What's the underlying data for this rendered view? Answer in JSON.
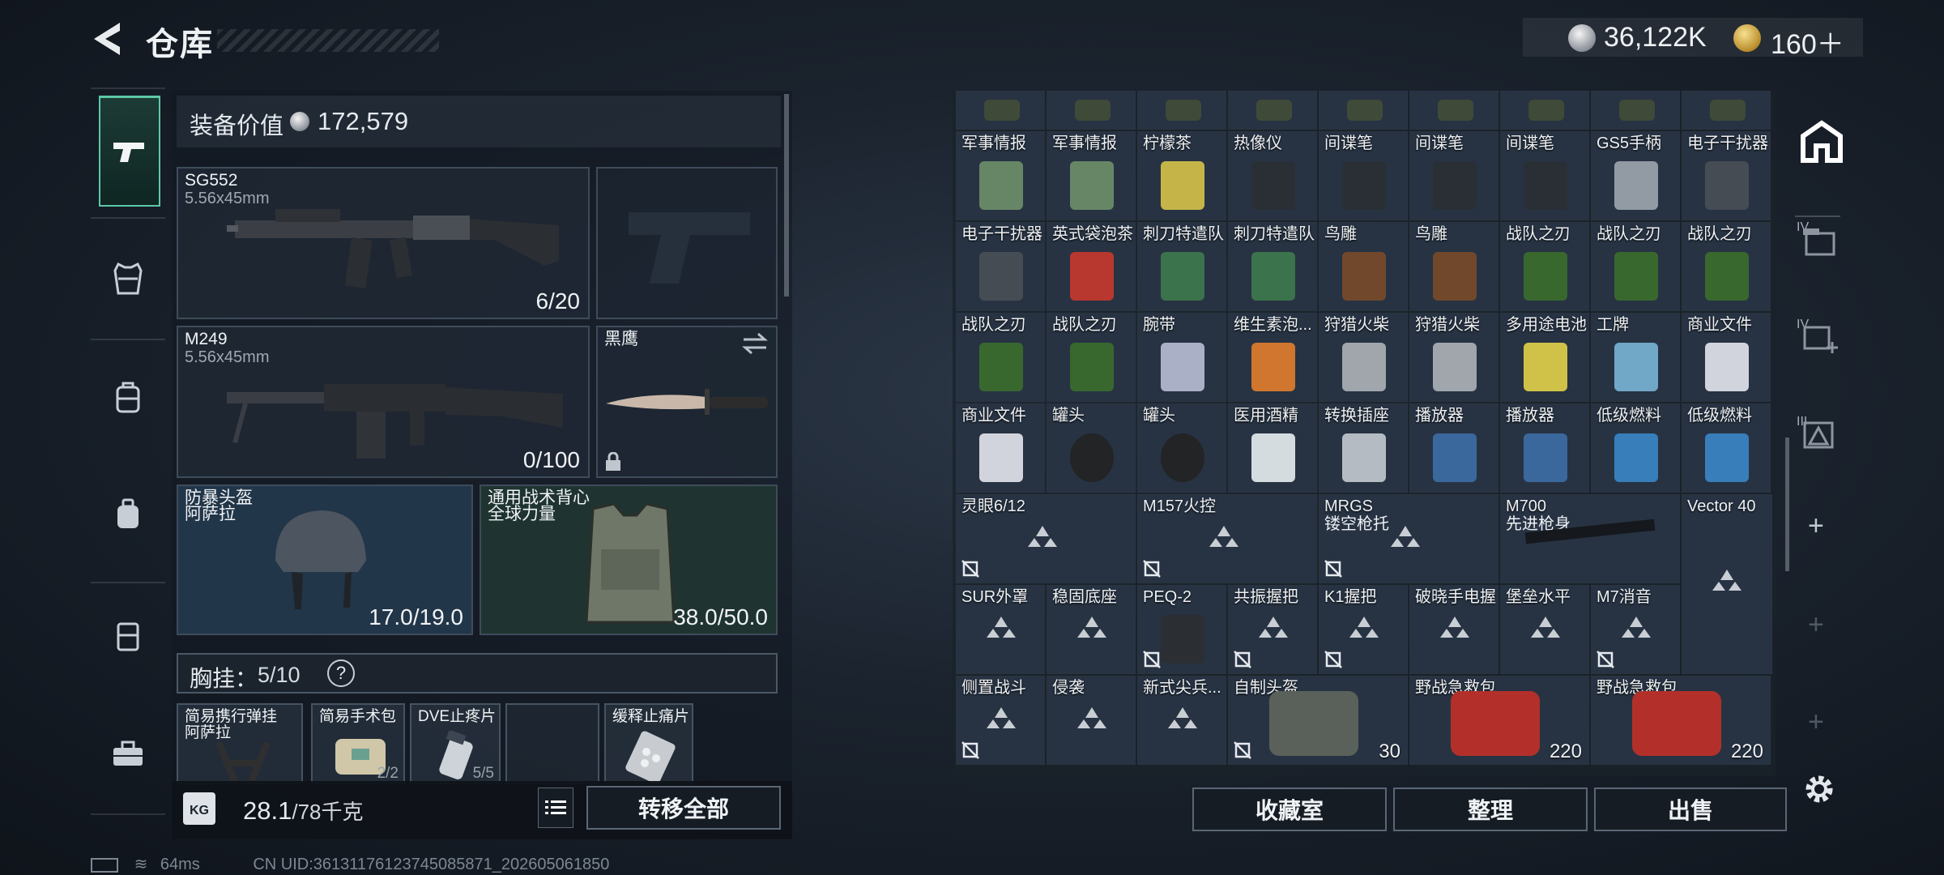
{
  "header": {
    "title": "仓库",
    "silver_amount": "36,122K",
    "gold_amount": "160＋"
  },
  "equipment": {
    "value_label": "装备价值",
    "value": "172,579",
    "primary": {
      "name": "SG552",
      "caliber": "5.56x45mm",
      "ammo": "6/20"
    },
    "secondary": {
      "name": "M249",
      "caliber": "5.56x45mm",
      "ammo": "0/100"
    },
    "melee": {
      "name": "黑鹰"
    },
    "helmet": {
      "name": "防暴头盔",
      "brand": "阿萨拉",
      "durability": "17.0/19.0"
    },
    "armor": {
      "name": "通用战术背心",
      "brand": "全球力量",
      "durability": "38.0/50.0"
    },
    "chest_rig": {
      "label": "胸挂：",
      "count": "5/10",
      "help": "?"
    },
    "chest_items": [
      {
        "name": "简易携行弹挂",
        "sub": "阿萨拉"
      },
      {
        "name": "简易手术包",
        "sub": "2/2"
      },
      {
        "name": "DVE止疼片",
        "sub": "5/5"
      },
      {
        "name": "",
        "sub": ""
      },
      {
        "name": "缓释止痛片",
        "sub": ""
      }
    ],
    "weight": "28.1",
    "weight_max": "/78千克",
    "transfer_all": "转移全部"
  },
  "storage": {
    "rows": [
      [
        "军事情报",
        "军事情报",
        "柠檬茶",
        "热像仪",
        "间谍笔",
        "间谍笔",
        "间谍笔",
        "GS5手柄",
        "电子干扰器"
      ],
      [
        "电子干扰器",
        "英式袋泡茶",
        "刺刀特遣队",
        "刺刀特遣队",
        "鸟雕",
        "鸟雕",
        "战队之刃",
        "战队之刃",
        "战队之刃"
      ],
      [
        "战队之刃",
        "战队之刃",
        "腕带",
        "维生素泡...",
        "狩猎火柴",
        "狩猎火柴",
        "多用途电池",
        "工牌",
        "商业文件"
      ],
      [
        "商业文件",
        "罐头",
        "罐头",
        "医用酒精",
        "转换插座",
        "播放器",
        "播放器",
        "低级燃料",
        "低级燃料"
      ]
    ],
    "row5": [
      {
        "name": "灵眼6/12"
      },
      {
        "name": "M157火控"
      },
      {
        "name": "MRGS",
        "sub": "镂空枪托"
      },
      {
        "name": "M700",
        "sub": "先进枪身"
      },
      {
        "name": "Vector 40"
      }
    ],
    "row6": [
      "SUR外罩",
      "稳固底座",
      "PEQ-2",
      "共振握把",
      "K1握把",
      "破晓手电握",
      "堡垒水平",
      "M7消音"
    ],
    "row7": [
      {
        "name": "侧置战斗"
      },
      {
        "name": "侵袭"
      },
      {
        "name": "新式尖兵..."
      },
      {
        "name": "自制头盔",
        "value": "30"
      },
      {
        "name": "野战急救包",
        "value": "220"
      },
      {
        "name": "野战急救包",
        "value": "220"
      }
    ]
  },
  "buttons": {
    "collection": "收藏室",
    "sort": "整理",
    "sell": "出售"
  },
  "status": {
    "ping": "64ms",
    "uid": "CN UID:36131176123745085871_202605061850"
  },
  "right_sidebar": {
    "tabs": [
      "IV",
      "IV",
      "III"
    ]
  },
  "colors": {
    "accent": "#5dc9a6",
    "cell_bg": "#273343",
    "panel_bg": "#1b232e"
  }
}
